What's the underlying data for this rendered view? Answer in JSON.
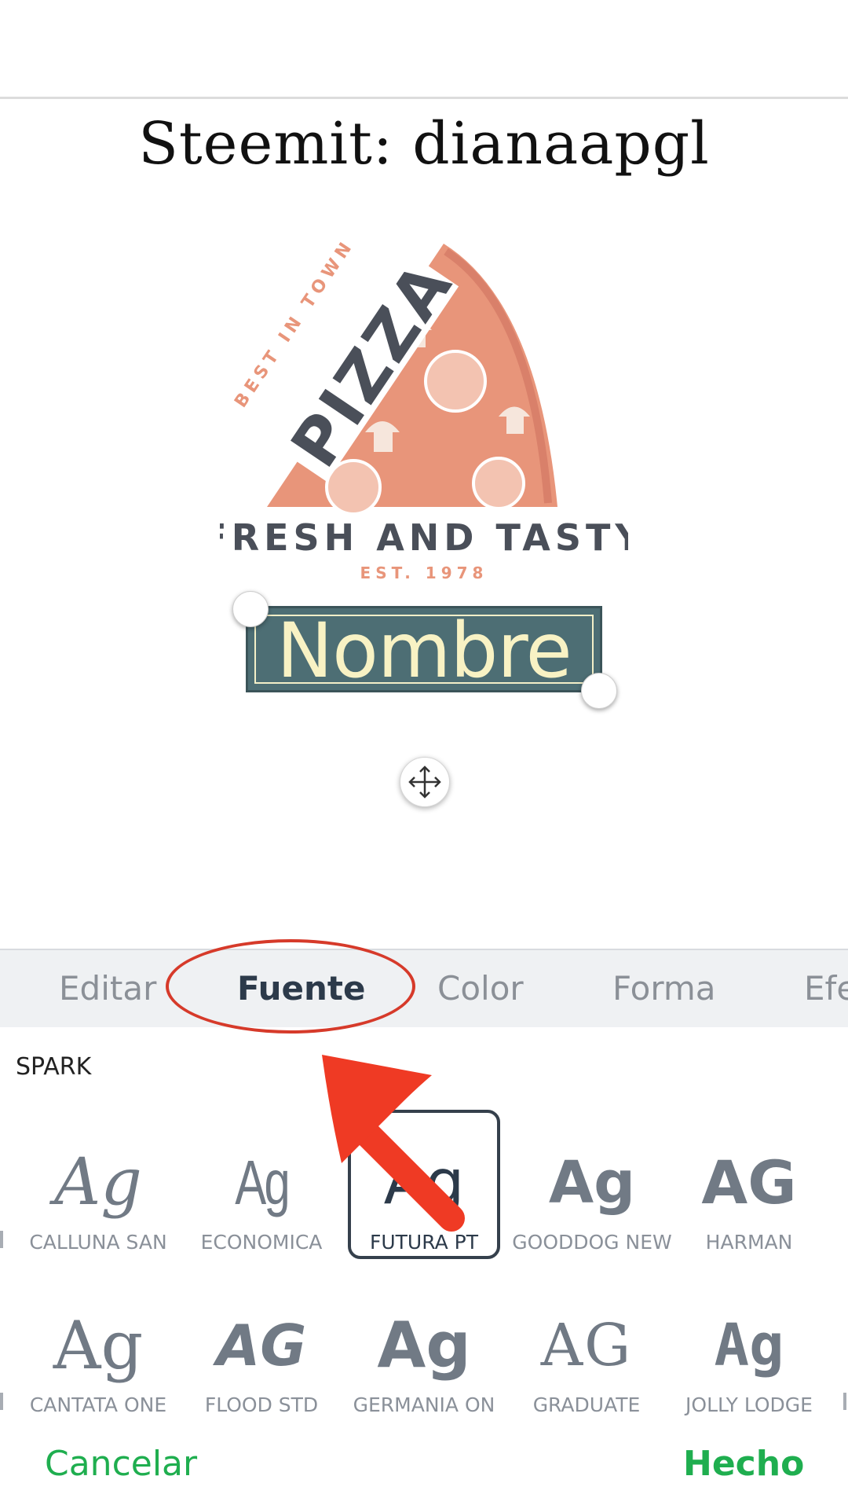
{
  "canvas": {
    "title": "Steemit: dianaapgl",
    "logo": {
      "top_text": "BEST IN TOWN",
      "main_text": "PIZZA",
      "tagline": "FRESH AND TASTY",
      "est": "EST. 1978"
    },
    "selected_text": "Nombre"
  },
  "tabs": [
    "Editar",
    "Fuente",
    "Color",
    "Forma",
    "Efe"
  ],
  "active_tab": "Fuente",
  "font_section": {
    "label": "SPARK",
    "row1": [
      {
        "sample": "Ag",
        "name": "CALLUNA SAN"
      },
      {
        "sample": "Ag",
        "name": "ECONOMICA"
      },
      {
        "sample": "Ag",
        "name": "FUTURA PT"
      },
      {
        "sample": "Ag",
        "name": "GOODDOG NEW"
      },
      {
        "sample": "AG",
        "name": "HARMAN"
      }
    ],
    "row2": [
      {
        "sample": "Ag",
        "name": "CANTATA ONE"
      },
      {
        "sample": "AG",
        "name": "FLOOD STD"
      },
      {
        "sample": "Ag",
        "name": "GERMANIA ON"
      },
      {
        "sample": "AG",
        "name": "GRADUATE"
      },
      {
        "sample": "Ag",
        "name": "JOLLY LODGE"
      }
    ],
    "selected_font": "FUTURA PT"
  },
  "footer": {
    "cancel_label": "Cancelar",
    "done_label": "Hecho"
  },
  "colors": {
    "accent_green": "#1fae4f",
    "annotation_red": "#d63a2a",
    "pizza_salmon": "#e8957a",
    "pizza_dark": "#4a4f59",
    "name_bg": "#4d6e74",
    "name_text": "#f8f2c4"
  }
}
